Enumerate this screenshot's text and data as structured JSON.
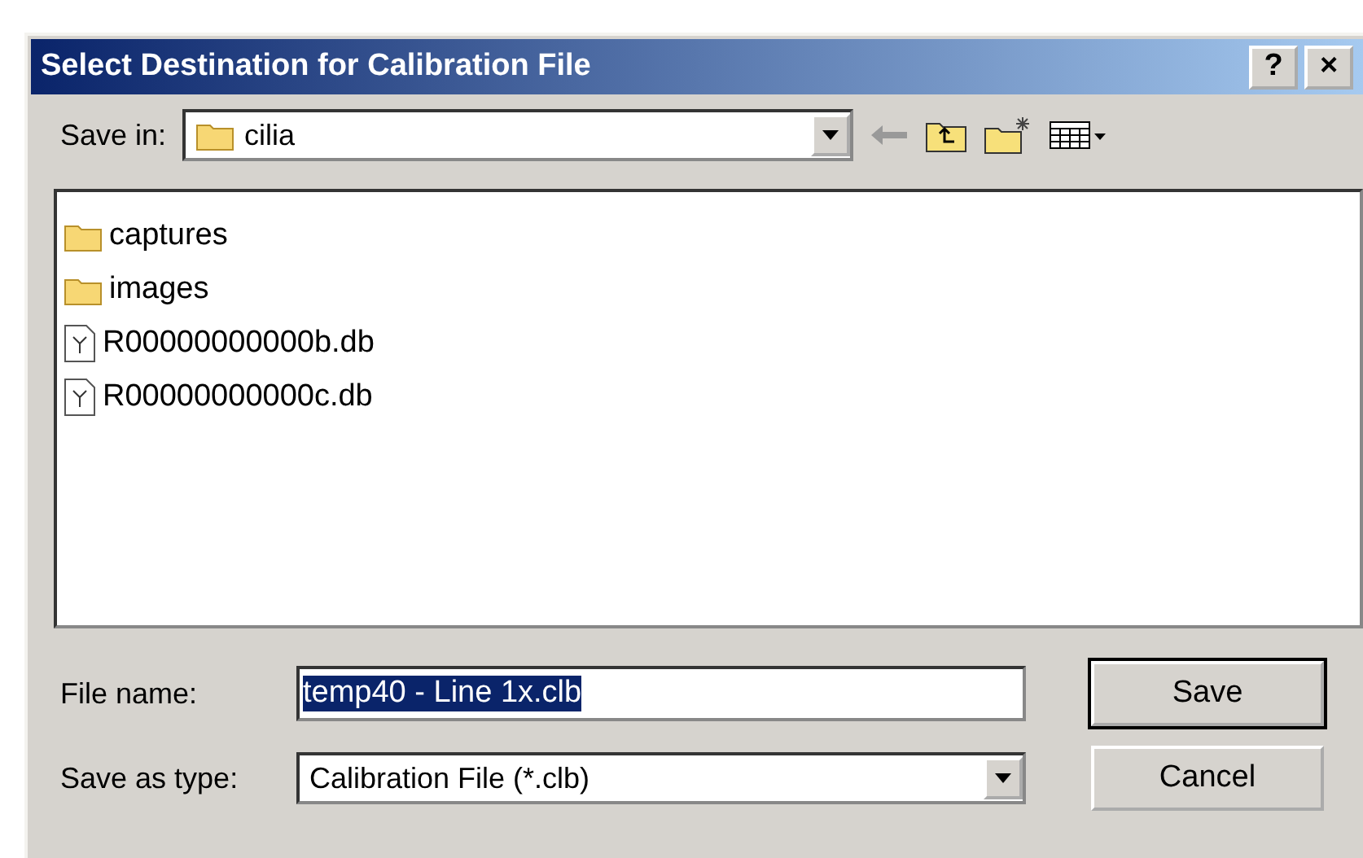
{
  "window": {
    "title": "Select Destination for Calibration File",
    "title_buttons": [
      "?",
      "×"
    ]
  },
  "save_in": {
    "label": "Save in:",
    "value": "cilia"
  },
  "files": [
    {
      "name": "captures",
      "kind": "folder"
    },
    {
      "name": "images",
      "kind": "folder"
    },
    {
      "name": "R00000000000b.db",
      "kind": "file"
    },
    {
      "name": "R00000000000c.db",
      "kind": "file"
    }
  ],
  "file_name": {
    "label": "File name:",
    "value": "temp40 - Line 1x.clb",
    "text_selected": true
  },
  "save_as_type": {
    "label": "Save as type:",
    "value": "Calibration File (*.clb)"
  },
  "buttons": [
    {
      "label": "Save",
      "default": true
    },
    {
      "label": "Cancel",
      "default": false
    }
  ]
}
